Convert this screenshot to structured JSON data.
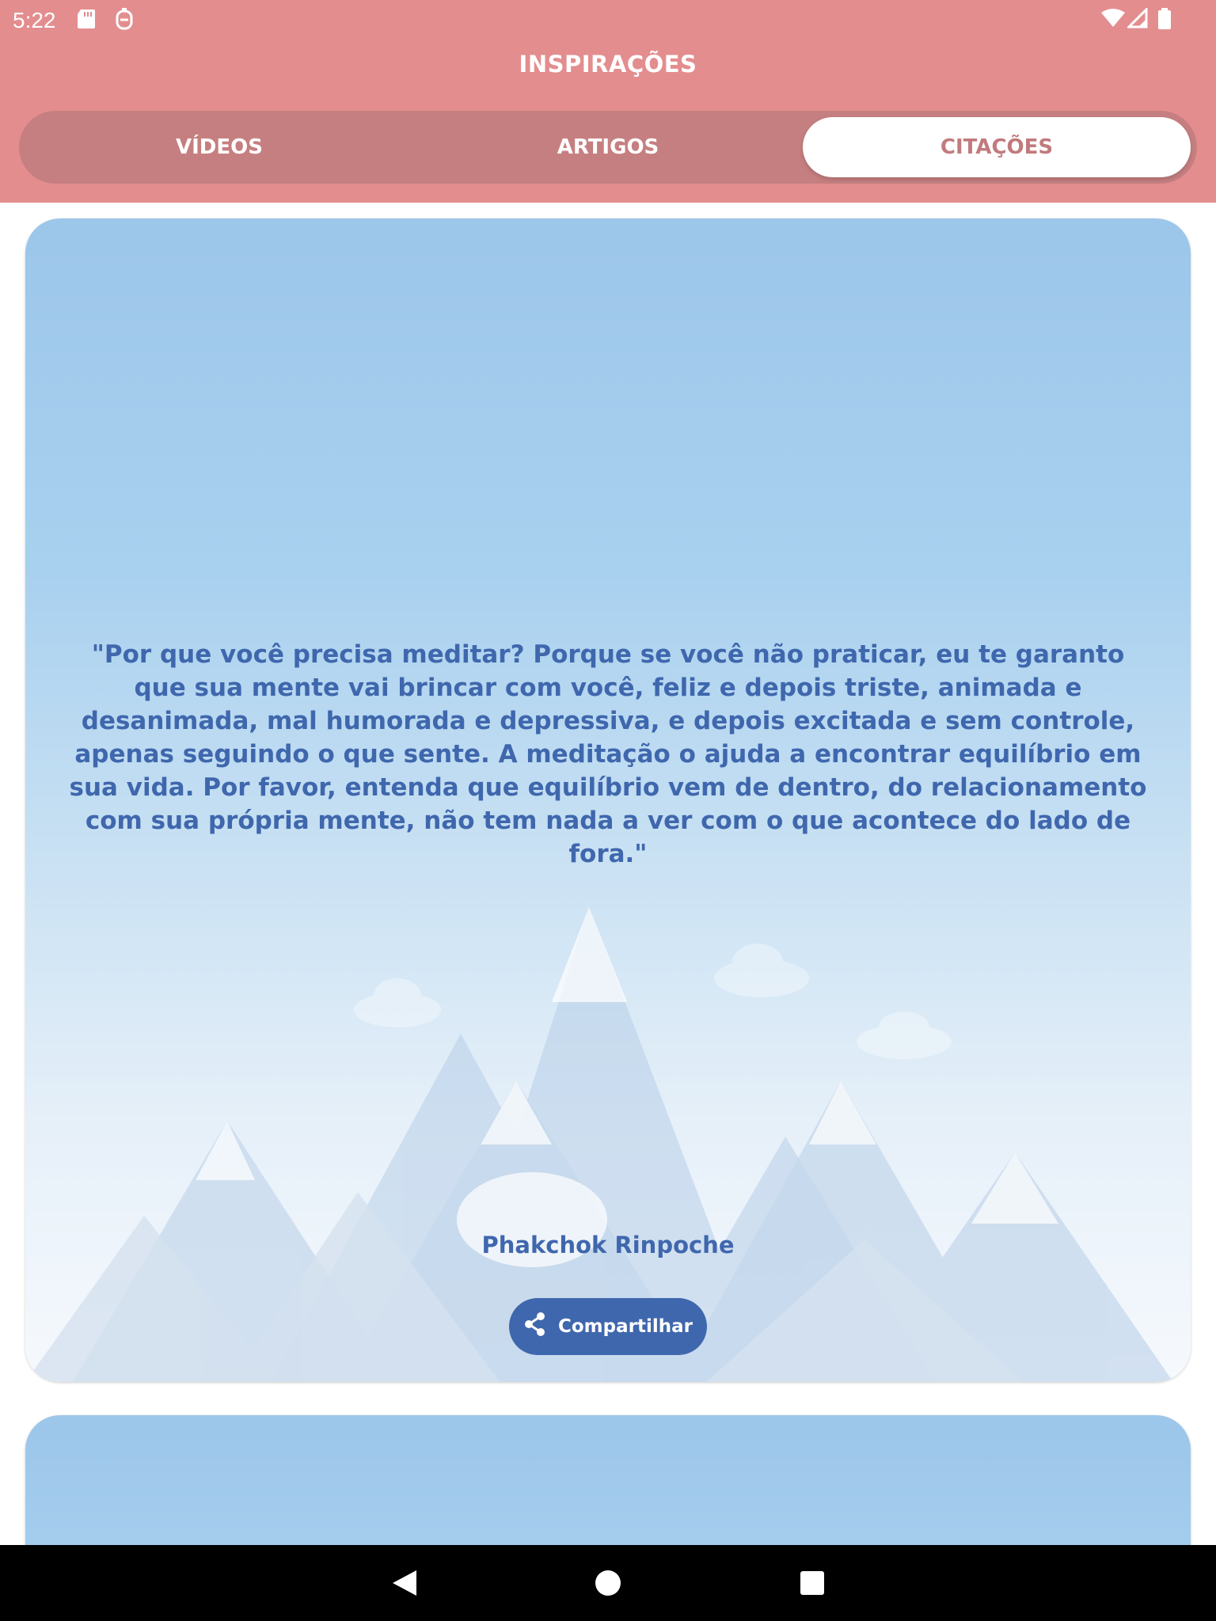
{
  "status_bar": {
    "time": "5:22",
    "icons": [
      "sd-card-icon",
      "notification-icon",
      "wifi-icon",
      "signal-icon",
      "battery-icon"
    ]
  },
  "header": {
    "title": "INSPIRAÇÕES",
    "tabs": [
      {
        "label": "VÍDEOS",
        "active": false
      },
      {
        "label": "ARTIGOS",
        "active": false
      },
      {
        "label": "CITAÇÕES",
        "active": true
      }
    ]
  },
  "cards": [
    {
      "quote": "\"Por que você precisa meditar? Porque se você não praticar, eu te garanto que sua mente vai brincar com você, feliz e depois triste, animada e desanimada, mal humorada e depressiva, e depois excitada e sem controle, apenas seguindo o que sente. A meditação o ajuda a encontrar equilíbrio em sua vida. Por favor, entenda que equilíbrio vem de dentro, do relacionamento com sua própria mente, não tem nada a ver com o que acontece do lado de fora.\"",
      "author": "Phakchok Rinpoche",
      "share_label": "Compartilhar"
    }
  ],
  "nav_bar": {
    "buttons": [
      "back-icon",
      "home-icon",
      "recents-icon"
    ]
  },
  "colors": {
    "header_bg": "#e38d8f",
    "tab_track": "#c67f80",
    "tab_active_text": "#c17a7d",
    "quote_text": "#3f67ad",
    "share_button_bg": "#3f67ad"
  }
}
